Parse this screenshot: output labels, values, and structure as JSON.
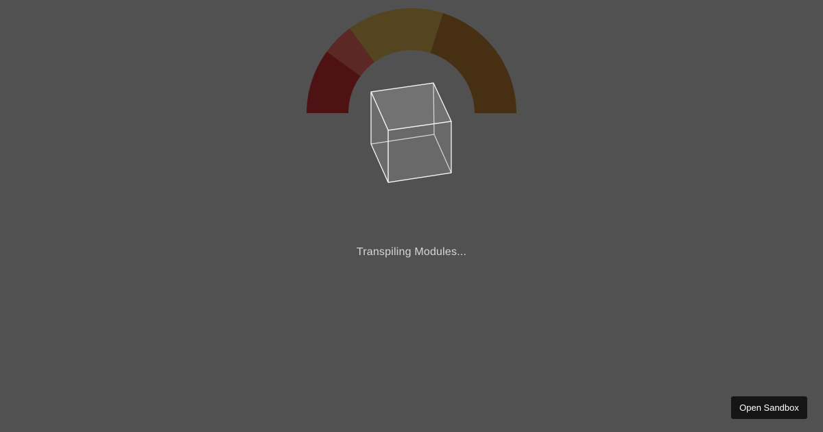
{
  "loader": {
    "status_text": "Transpiling Modules...",
    "gauge_segment_colors": [
      "#4e1114",
      "#5b2825",
      "#544420",
      "#472f13"
    ]
  },
  "actions": {
    "open_sandbox_label": "Open Sandbox"
  }
}
